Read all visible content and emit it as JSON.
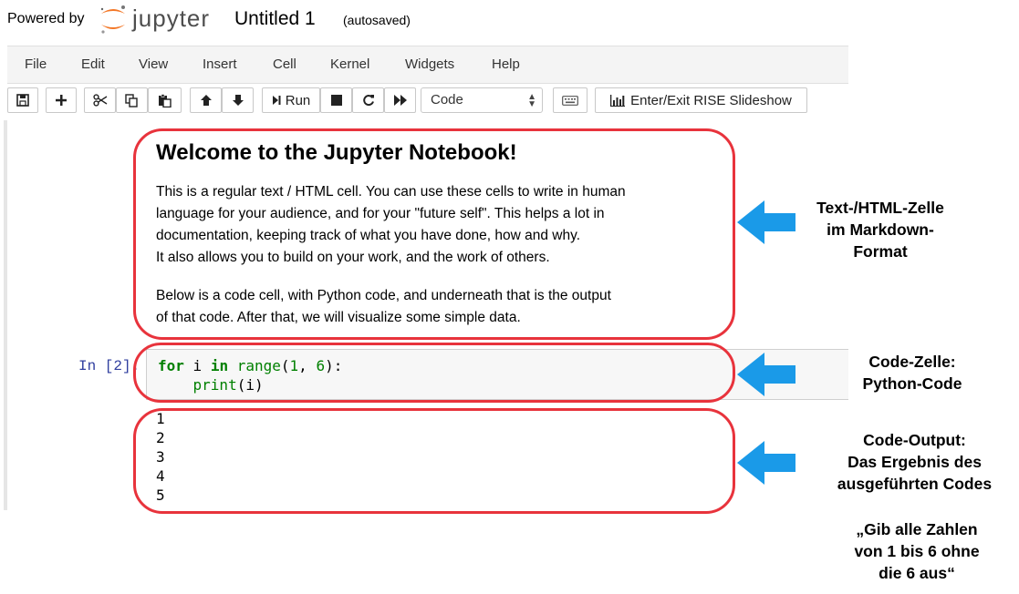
{
  "header": {
    "powered_by": "Powered by",
    "logo_word": "jupyter",
    "notebook_title": "Untitled 1",
    "autosave_status": "(autosaved)"
  },
  "menu": [
    "File",
    "Edit",
    "View",
    "Insert",
    "Cell",
    "Kernel",
    "Widgets",
    "Help"
  ],
  "toolbar": {
    "run_label": "Run",
    "cell_type": "Code",
    "rise_label": "Enter/Exit RISE Slideshow",
    "icons": [
      "save-icon",
      "plus-icon",
      "cut-icon",
      "copy-icon",
      "paste-icon",
      "arrow-up-icon",
      "arrow-down-icon",
      "run-icon",
      "stop-icon",
      "restart-icon",
      "fast-forward-icon",
      "keyboard-icon",
      "bar-chart-icon"
    ]
  },
  "markdown_cell": {
    "title": "Welcome to the Jupyter Notebook!",
    "lines": [
      "This is a regular text / HTML cell. You can use these cells to write in human",
      "language for your audience, and for your \"future self\". This helps a lot in",
      "documentation, keeping track of what you have done, how and why.",
      "It also allows you to build on your work, and the work of others.",
      "Below is a code cell, with Python code, and underneath that is the output",
      "of that code. After that, we will visualize some simple data."
    ]
  },
  "code_cell": {
    "prompt": "In [2]:",
    "line1": {
      "kw_for": "for",
      "var": " i ",
      "kw_in": "in",
      "builtin": "range",
      "open": "(",
      "n1": "1",
      "sep": ", ",
      "n2": "6",
      "close": "):"
    },
    "line2": {
      "indent": "    ",
      "builtin": "print",
      "args": "(i)"
    }
  },
  "output": [
    "1",
    "2",
    "3",
    "4",
    "5"
  ],
  "annotations": {
    "markdown": [
      "Text-/HTML-Zelle",
      "im Markdown-",
      "Format"
    ],
    "code": [
      "Code-Zelle:",
      "Python-Code"
    ],
    "output": [
      "Code-Output:",
      "Das Ergebnis des",
      "ausgeführten Codes"
    ],
    "quote": [
      "„Gib alle Zahlen",
      "von 1 bis 6 ohne",
      "die 6 aus“"
    ]
  },
  "colors": {
    "frame": "#e8333c",
    "arrow": "#1a9ae8",
    "prompt": "#303f9f",
    "keyword": "#008000"
  }
}
